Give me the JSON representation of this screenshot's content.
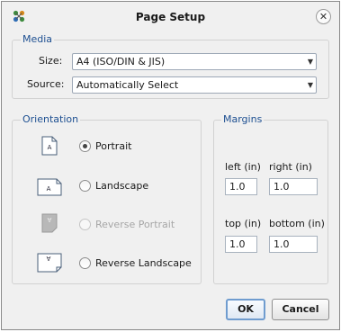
{
  "window": {
    "title": "Page Setup"
  },
  "media": {
    "legend": "Media",
    "size_label": "Size:",
    "size_value": "A4 (ISO/DIN & JIS)",
    "source_label": "Source:",
    "source_value": "Automatically Select"
  },
  "orientation": {
    "legend": "Orientation",
    "options": [
      {
        "label": "Portrait",
        "checked": true,
        "enabled": true,
        "icon": "portrait-page-icon"
      },
      {
        "label": "Landscape",
        "checked": false,
        "enabled": true,
        "icon": "landscape-page-icon"
      },
      {
        "label": "Reverse Portrait",
        "checked": false,
        "enabled": false,
        "icon": "reverse-portrait-page-icon"
      },
      {
        "label": "Reverse Landscape",
        "checked": false,
        "enabled": true,
        "icon": "reverse-landscape-page-icon"
      }
    ]
  },
  "margins": {
    "legend": "Margins",
    "left_label": "left (in)",
    "left_value": "1.0",
    "right_label": "right (in)",
    "right_value": "1.0",
    "top_label": "top (in)",
    "top_value": "1.0",
    "bottom_label": "bottom (in)",
    "bottom_value": "1.0"
  },
  "buttons": {
    "ok": "OK",
    "cancel": "Cancel"
  },
  "colors": {
    "legend": "#1d4f91",
    "default_button_border": "#6f9ccf",
    "disabled_text": "#a6a6a6"
  }
}
